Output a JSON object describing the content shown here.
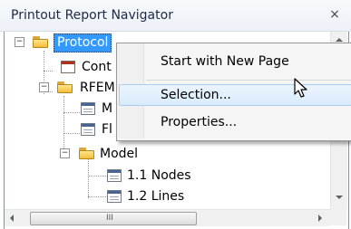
{
  "window": {
    "title": "Printout Report Navigator",
    "close_glyph": "×"
  },
  "tree": {
    "nodes": [
      {
        "label": "Protocol",
        "expander": "−",
        "icon": "folder-icon",
        "selected": true
      },
      {
        "label": "Cont",
        "icon": "toc-icon"
      },
      {
        "label": "RFEM",
        "expander": "−",
        "icon": "folder-icon"
      },
      {
        "label": "M",
        "icon": "page-icon"
      },
      {
        "label": "Fl",
        "icon": "page-icon"
      },
      {
        "label": "Model",
        "expander": "−",
        "icon": "folder-icon"
      },
      {
        "label": "1.1 Nodes",
        "icon": "page-icon"
      },
      {
        "label": "1.2 Lines",
        "icon": "page-icon"
      }
    ]
  },
  "context_menu": {
    "items": [
      {
        "label": "Start with New Page"
      },
      {
        "label": "Selection...",
        "hovered": true
      },
      {
        "label": "Properties..."
      }
    ]
  },
  "scrollbar": {
    "thumb_grip": "III"
  },
  "colors": {
    "selection": "#3399ff",
    "menu_hover": "#d9ebfb",
    "folder": "#f3bf3a"
  }
}
